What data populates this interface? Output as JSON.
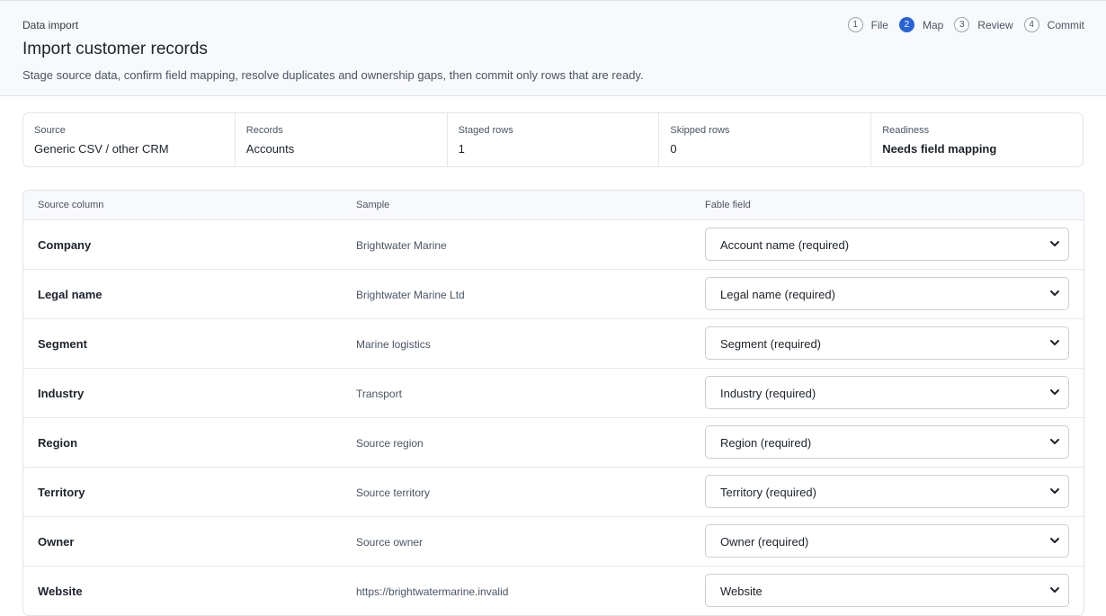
{
  "header": {
    "eyebrow": "Data import",
    "title": "Import customer records",
    "description": "Stage source data, confirm field mapping, resolve duplicates and ownership gaps, then commit only rows that are ready."
  },
  "steps": [
    {
      "num": "1",
      "label": "File",
      "active": false
    },
    {
      "num": "2",
      "label": "Map",
      "active": true
    },
    {
      "num": "3",
      "label": "Review",
      "active": false
    },
    {
      "num": "4",
      "label": "Commit",
      "active": false
    }
  ],
  "stats": [
    {
      "label": "Source",
      "value": "Generic CSV / other CRM"
    },
    {
      "label": "Records",
      "value": "Accounts"
    },
    {
      "label": "Staged rows",
      "value": "1"
    },
    {
      "label": "Skipped rows",
      "value": "0"
    },
    {
      "label": "Readiness",
      "value": "Needs field mapping"
    }
  ],
  "table": {
    "headers": {
      "source_column": "Source column",
      "sample": "Sample",
      "fable_field": "Fable field"
    },
    "rows": [
      {
        "column": "Company",
        "sample": "Brightwater Marine",
        "field": "Account name (required)"
      },
      {
        "column": "Legal name",
        "sample": "Brightwater Marine Ltd",
        "field": "Legal name (required)"
      },
      {
        "column": "Segment",
        "sample": "Marine logistics",
        "field": "Segment (required)"
      },
      {
        "column": "Industry",
        "sample": "Transport",
        "field": "Industry (required)"
      },
      {
        "column": "Region",
        "sample": "Source region",
        "field": "Region (required)"
      },
      {
        "column": "Territory",
        "sample": "Source territory",
        "field": "Territory (required)"
      },
      {
        "column": "Owner",
        "sample": "Source owner",
        "field": "Owner (required)"
      },
      {
        "column": "Website",
        "sample": "https://brightwatermarine.invalid",
        "field": "Website"
      }
    ]
  },
  "colors": {
    "accent": "#2a62d6",
    "border": "#dfe4ea",
    "header_bg": "#f7f9fc"
  },
  "icons": {
    "select": "chevron-down-icon"
  }
}
